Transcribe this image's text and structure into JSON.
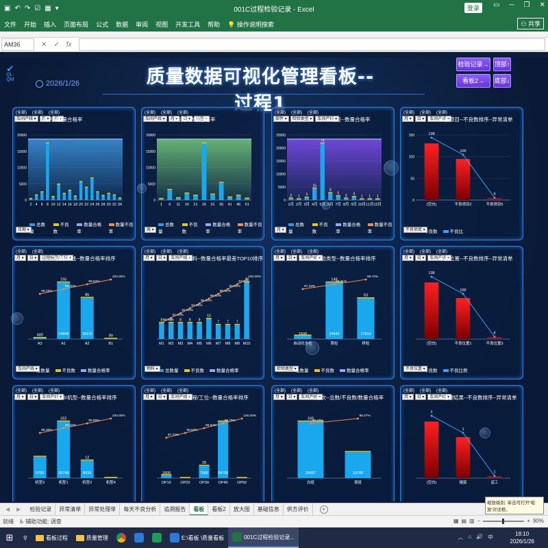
{
  "window": {
    "title": "001C过程检验记录  -  Excel",
    "login_label": "登录",
    "share_label": "共享"
  },
  "ribbon": {
    "tabs": [
      "文件",
      "开始",
      "插入",
      "页面布局",
      "公式",
      "数据",
      "审阅",
      "视图",
      "开发工具",
      "帮助",
      "操作说明搜索"
    ]
  },
  "formula": {
    "namebox": "AM36",
    "value": ""
  },
  "dashboard": {
    "title": "质量数据可视化管理看板--过程1",
    "date": "2026/1/26",
    "logo_text": "QL-QM",
    "nav": [
      "检验记录→",
      "顶部↑",
      "看板2→",
      "底部↓"
    ]
  },
  "panels": [
    {
      "title": "每天--数量合格率",
      "labels": [
        "(全部)",
        "(全部)",
        "(全部)"
      ],
      "filters": [
        "车间产线",
        "月",
        "日"
      ],
      "bottom_filter": "日期",
      "legend": [
        "总数量",
        "不良数",
        "数量合格率",
        "数量不良率"
      ]
    },
    {
      "title": "每周--数量合格率",
      "labels": [
        "(全部)",
        "(全部)",
        "(全部)"
      ],
      "filters": [
        "车间产线",
        "月",
        "日",
        "标签"
      ],
      "bottom_filter": "周",
      "legend": [
        "总数量",
        "不良数",
        "数量合格率",
        "数量不良率"
      ]
    },
    {
      "title": "每月--数量合格率",
      "labels": [
        "(全部)",
        "(全部)",
        "(全部)"
      ],
      "filters": [
        "部件",
        "检验类型",
        "车间产线"
      ],
      "bottom_filter": "月",
      "legend": [
        "总数量",
        "不良数",
        "数量合格率",
        "数量不良率"
      ]
    },
    {
      "title": "不良项目--不良数排序--异常清单",
      "labels": [
        "(全部)",
        "(全部)",
        "(全部)"
      ],
      "filters": [
        "月",
        "日",
        "车间产线"
      ],
      "bottom_filter": "不良项目",
      "legend": [
        "不良数",
        "不良比"
      ]
    },
    {
      "title": "车间/产线--数量合格率排序",
      "labels": [
        "(全部)",
        "(全部)"
      ],
      "filters": [
        "月",
        "日",
        "过程标签/工位"
      ],
      "bottom_filter": "车间产线",
      "legend": [
        "总数量",
        "不良数",
        "数量合格率"
      ]
    },
    {
      "title": "物料--数量合格率最差TOP10排序",
      "labels": [
        "(全部)",
        "(全部)",
        "(全部)"
      ],
      "filters": [
        "月",
        "日",
        "车间产线"
      ],
      "bottom_filter": "物料",
      "legend": [
        "总数量",
        "不良数",
        "数量合格率"
      ]
    },
    {
      "title": "检验类型--数量合格率排序",
      "labels": [
        "(全部)",
        "(全部)",
        "(全部)"
      ],
      "filters": [
        "月",
        "日",
        "车间产线"
      ],
      "bottom_filter": "检验类型",
      "legend": [
        "总数量",
        "不良数",
        "数量合格率"
      ]
    },
    {
      "title": "不良位置--不良数排序--异常清单",
      "labels": [
        "(全部)",
        "(全部)",
        "(全部)"
      ],
      "filters": [
        "月",
        "日",
        "车间产线"
      ],
      "bottom_filter": "不良位置",
      "legend": [
        "不良数",
        "不良比例"
      ]
    },
    {
      "title": "机种/机型--数量合格率排序",
      "labels": [
        "(全部)",
        "(全部)",
        "(全部)"
      ],
      "filters": [
        "月",
        "日",
        "车间产线"
      ],
      "bottom_filter": "",
      "legend": []
    },
    {
      "title": "过程/工位--数量合格率排序",
      "labels": [
        "(全部)",
        "(全部)",
        "(全部)"
      ],
      "filters": [
        "月",
        "日",
        "车间产线"
      ],
      "bottom_filter": "",
      "legend": []
    },
    {
      "title": "班次--总数/不良数/数量合格率",
      "labels": [
        "(全部)",
        "(全部)",
        "(全部)"
      ],
      "filters": [
        "月",
        "日",
        "车间产线"
      ],
      "bottom_filter": "",
      "legend": []
    },
    {
      "title": "处理结果--不良数排序--异常清单",
      "labels": [
        "(全部)",
        "(全部)",
        "(全部)"
      ],
      "filters": [
        "月",
        "日",
        "车间产线"
      ],
      "bottom_filter": "",
      "legend": []
    }
  ],
  "chart_data": [
    {
      "type": "bar",
      "categories": [
        "2",
        "4",
        "6",
        "8",
        "10",
        "12",
        "14",
        "16",
        "18",
        "20",
        "22",
        "24",
        "26",
        "28",
        "30",
        "32",
        "34"
      ],
      "values": [
        200,
        900,
        1500,
        11000,
        600,
        3000,
        1200,
        1800,
        700,
        3500,
        2400,
        4200,
        1500,
        800,
        1200,
        900,
        300
      ],
      "y_ticks": [
        "0",
        "5000",
        "10000",
        "15000",
        "20000"
      ]
    },
    {
      "type": "bar",
      "categories": [
        "1",
        "6",
        "11",
        "16",
        "21",
        "26",
        "31",
        "36",
        "41",
        "46",
        "51"
      ],
      "values": [
        300,
        2800,
        500,
        1800,
        1200,
        15800,
        1500,
        4800,
        700,
        1200,
        400
      ],
      "y_ticks": [
        "0",
        "5000",
        "10000",
        "15000",
        "20000"
      ]
    },
    {
      "type": "bar",
      "categories": [
        "1月",
        "2月",
        "3月",
        "4月",
        "5月",
        "6月",
        "7月",
        "8月",
        "9月",
        "10月",
        "11月",
        "12月"
      ],
      "values": [
        2,
        1,
        3,
        15,
        74,
        9,
        5,
        2,
        4,
        1,
        1,
        1
      ],
      "y_ticks": [
        "0",
        "5000",
        "10000",
        "15000",
        "20000",
        "25000"
      ]
    },
    {
      "type": "bar",
      "categories": [
        "(空白)",
        "不良项目2",
        "不良项目5"
      ],
      "values": [
        138,
        100,
        4
      ],
      "line_labels": [
        "138",
        "100",
        "4"
      ],
      "y_ticks": [
        "0",
        "50",
        "100",
        "150"
      ]
    },
    {
      "type": "bar",
      "categories": [
        "A3",
        "A1",
        "A2",
        "B1"
      ],
      "values": [
        480,
        24848,
        18110,
        99
      ],
      "top_labels": [
        "480",
        "150",
        "85",
        "99"
      ],
      "rates": [
        "98.25%",
        "99.40%",
        "99.53%",
        "100.00%"
      ]
    },
    {
      "type": "bar",
      "categories": [
        "M1",
        "M2",
        "M3",
        "M4",
        "M5",
        "M6",
        "M7",
        "M8",
        "M9",
        "M10"
      ],
      "values": [
        8,
        8,
        8,
        8,
        8,
        10,
        7,
        7,
        7,
        28
      ],
      "rates": [
        "90.00%",
        "91.00%",
        "91.00%",
        "91.00%",
        "95.00%",
        "96.50%",
        "96.50%",
        "96.50%",
        "97.41%",
        "100.00%"
      ]
    },
    {
      "type": "bar",
      "categories": [
        "自动化全检",
        "首检",
        "终检"
      ],
      "values": [
        1500,
        24442,
        17610
      ],
      "top_labels": [
        "",
        "149",
        "53"
      ],
      "rates": [
        "97.33%",
        "99.31%",
        "99.70%"
      ]
    },
    {
      "type": "bar",
      "categories": [
        "(空白)",
        "不良位置1",
        "不良位置3"
      ],
      "values": [
        138,
        100,
        4
      ],
      "line_labels": [
        "138",
        "100",
        "4"
      ]
    },
    {
      "type": "bar",
      "categories": [
        "机型3",
        "机型1",
        "机型2",
        "机型4"
      ],
      "values": [
        9700,
        25748,
        8010,
        99
      ],
      "top_labels": [
        "",
        "252",
        "12",
        ""
      ],
      "rates": [
        "98.30%",
        "99.02%",
        "99.85%",
        "100.00%"
      ]
    },
    {
      "type": "bar",
      "categories": [
        "OP10",
        "OP20",
        "OP30",
        "OP40",
        "OP50"
      ],
      "values": [
        1800,
        96,
        7560,
        34700,
        99
      ],
      "top_labels": [
        "",
        "",
        "29",
        "",
        ""
      ],
      "rates": [
        "97.73%",
        "98.92%",
        "99.62%",
        "99.79%",
        "100.00%"
      ]
    },
    {
      "type": "bar",
      "categories": [
        "白班",
        "夜班"
      ],
      "values": [
        29657,
        13700
      ],
      "top_labels": [
        "169",
        ""
      ],
      "rates": [
        "99.43%",
        "99.47%"
      ]
    },
    {
      "type": "bar",
      "categories": [
        "(空白)",
        "报废",
        "返工"
      ],
      "values": [
        138,
        100,
        4
      ],
      "line_labels": [
        "1",
        "1",
        "1"
      ]
    }
  ],
  "sheets": [
    "检验记录",
    "异常清单",
    "异常处理单",
    "每天不良分析",
    "追溯报告",
    "看板",
    "看板2",
    "放大图",
    "基础信息",
    "供方评价"
  ],
  "active_sheet": "看板",
  "status": {
    "left": "就绪",
    "accessibility": "辅助功能: 调查",
    "zoom": "90%"
  },
  "tooltip": "缩放级别, 单击可打开'缩放'对话框。",
  "taskbar": {
    "items": [
      "看板过程",
      "质量管理",
      "E:\\看板 \\质量看板",
      "001C过程检验记录..."
    ],
    "time": "18:10",
    "date": "2026/1/26",
    "lang": "中"
  }
}
